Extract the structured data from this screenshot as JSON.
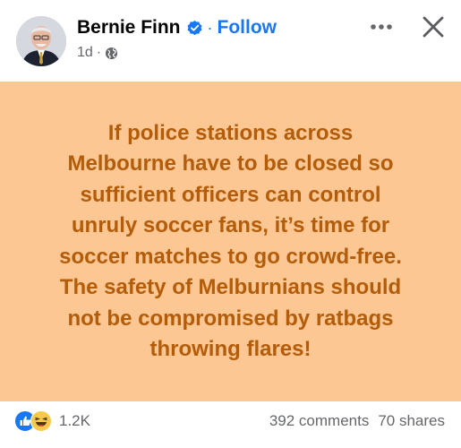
{
  "post": {
    "author": "Bernie Finn",
    "follow_label": "Follow",
    "separator": "·",
    "timestamp": "1d",
    "audience_icon": "globe-icon",
    "verified_icon": "verified-badge-icon",
    "text": "If police stations across\nMelbourne have to be closed so\nsufficient officers can control\nunruly soccer fans, it’s time for\nsoccer matches to go crowd-free.\nThe safety of Melburnians should\nnot be compromised by ratbags\nthrowing flares!",
    "background_color": "#fdc793",
    "text_color": "#b35c0a"
  },
  "footer": {
    "reaction_icons": [
      "like-icon",
      "haha-icon"
    ],
    "reaction_count": "1.2K",
    "comments": "392 comments",
    "shares": "70 shares"
  },
  "toolbar": {
    "more_icon": "more-options-icon",
    "close_icon": "close-icon"
  },
  "colors": {
    "link_blue": "#1877f2",
    "secondary_text": "#65676b"
  }
}
